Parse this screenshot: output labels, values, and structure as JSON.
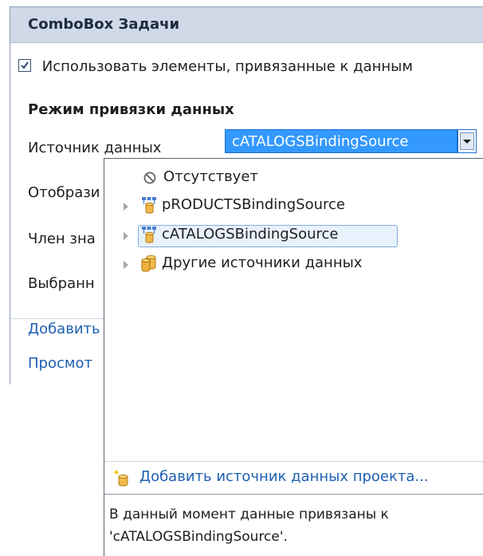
{
  "panel": {
    "title": "ComboBox Задачи",
    "use_bound_items_label": "Использовать элементы, привязанные к данным",
    "use_bound_items_checked": true,
    "section_title": "Режим привязки данных",
    "labels": {
      "data_source": "Источник данных",
      "display_member": "Отобрази",
      "value_member": "Член зна",
      "selected_value": "Выбранн"
    },
    "links": {
      "add_query": "Добавить",
      "preview": "Просмот"
    },
    "data_source_value": "cATALOGSBindingSource"
  },
  "dropdown": {
    "items": [
      {
        "label": "Отсутствует",
        "icon": "none-icon"
      },
      {
        "label": "pRODUCTSBindingSource",
        "icon": "binding-source-icon"
      },
      {
        "label": "cATALOGSBindingSource",
        "icon": "binding-source-icon",
        "selected": true
      },
      {
        "label": "Другие источники данных",
        "icon": "database-icon"
      }
    ],
    "add_project_source_label": "Добавить источник данных проекта...",
    "status_line1": "В данный момент данные привязаны к",
    "status_line2": "'cATALOGSBindingSource'."
  },
  "colors": {
    "header_bg": "#cfd9e7",
    "selection_bg": "#3399ff",
    "link": "#1d5fb3",
    "tree_selected_bg": "#e8f2fd"
  }
}
